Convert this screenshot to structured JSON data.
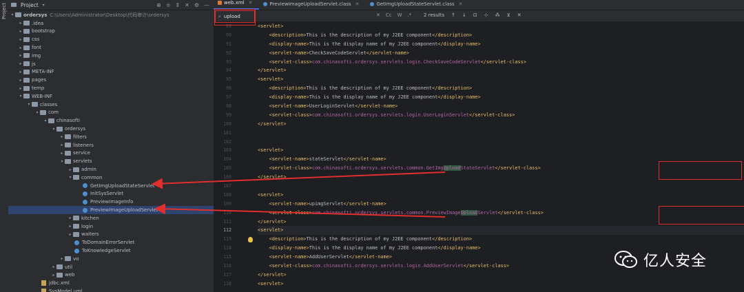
{
  "project_panel": {
    "title": "Project",
    "vertical_tab": "Project",
    "root_name": "ordersys",
    "root_path": "C:\\Users\\Administrator\\Desktop\\代码审计\\ordersys",
    "tree": [
      {
        "label": "ordersys",
        "depth": 0,
        "kind": "folder",
        "expanded": true
      },
      {
        "label": ".idea",
        "depth": 1,
        "kind": "folder",
        "expanded": false
      },
      {
        "label": "bootstrap",
        "depth": 1,
        "kind": "folder",
        "expanded": false
      },
      {
        "label": "css",
        "depth": 1,
        "kind": "folder",
        "expanded": false
      },
      {
        "label": "font",
        "depth": 1,
        "kind": "folder",
        "expanded": false
      },
      {
        "label": "img",
        "depth": 1,
        "kind": "folder",
        "expanded": false
      },
      {
        "label": "js",
        "depth": 1,
        "kind": "folder",
        "expanded": false
      },
      {
        "label": "META-INF",
        "depth": 1,
        "kind": "folder",
        "expanded": false
      },
      {
        "label": "pages",
        "depth": 1,
        "kind": "folder",
        "expanded": false
      },
      {
        "label": "temp",
        "depth": 1,
        "kind": "folder",
        "expanded": false
      },
      {
        "label": "WEB-INF",
        "depth": 1,
        "kind": "folder",
        "expanded": true
      },
      {
        "label": "classes",
        "depth": 2,
        "kind": "folder",
        "expanded": true
      },
      {
        "label": "com",
        "depth": 3,
        "kind": "folder",
        "expanded": true
      },
      {
        "label": "chinasofti",
        "depth": 4,
        "kind": "folder",
        "expanded": true
      },
      {
        "label": "ordersys",
        "depth": 5,
        "kind": "folder",
        "expanded": true
      },
      {
        "label": "filters",
        "depth": 6,
        "kind": "folder",
        "expanded": false
      },
      {
        "label": "listeners",
        "depth": 6,
        "kind": "folder",
        "expanded": false
      },
      {
        "label": "service",
        "depth": 6,
        "kind": "folder",
        "expanded": false
      },
      {
        "label": "servlets",
        "depth": 6,
        "kind": "folder",
        "expanded": true
      },
      {
        "label": "admin",
        "depth": 7,
        "kind": "folder",
        "expanded": false
      },
      {
        "label": "common",
        "depth": 7,
        "kind": "folder",
        "expanded": true
      },
      {
        "label": "GetImgUploadStateServlet",
        "depth": 8,
        "kind": "class"
      },
      {
        "label": "InitSysServlet",
        "depth": 8,
        "kind": "class"
      },
      {
        "label": "PreviewImageInfo",
        "depth": 8,
        "kind": "class"
      },
      {
        "label": "PreviewImageUploadServlet",
        "depth": 8,
        "kind": "class",
        "selected": true
      },
      {
        "label": "kitchen",
        "depth": 7,
        "kind": "folder",
        "expanded": false
      },
      {
        "label": "login",
        "depth": 7,
        "kind": "folder",
        "expanded": false
      },
      {
        "label": "waiters",
        "depth": 7,
        "kind": "folder",
        "expanded": false
      },
      {
        "label": "ToDomainErrorServlet",
        "depth": 7,
        "kind": "class"
      },
      {
        "label": "ToKnowledgeServlet",
        "depth": 7,
        "kind": "class"
      },
      {
        "label": "vo",
        "depth": 6,
        "kind": "folder",
        "expanded": false
      },
      {
        "label": "util",
        "depth": 5,
        "kind": "folder",
        "expanded": false
      },
      {
        "label": "web",
        "depth": 5,
        "kind": "folder",
        "expanded": false
      },
      {
        "label": "jdbc.xml",
        "depth": 3,
        "kind": "file"
      },
      {
        "label": "SysModel.uml",
        "depth": 3,
        "kind": "file"
      }
    ]
  },
  "tabs": [
    {
      "label": "web.xml",
      "type": "xml",
      "active": true
    },
    {
      "label": "PreviewImageUploadServlet.class",
      "type": "class",
      "active": false
    },
    {
      "label": "GetImgUploadStateServlet.class",
      "type": "class",
      "active": false
    }
  ],
  "find": {
    "query": "upload",
    "match_case": "Cc",
    "words": "W",
    "regex": ".*",
    "results": "2 results"
  },
  "code": {
    "current_line": 112,
    "lines": [
      {
        "n": 89,
        "text": "<servlet>"
      },
      {
        "n": 90,
        "text": "    <description>This is the description of my J2EE component</description>"
      },
      {
        "n": 91,
        "text": "    <display-name>This is the display name of my J2EE component</display-name>"
      },
      {
        "n": 92,
        "text": "    <servlet-name>CheckSaveCodeServlet</servlet-name>"
      },
      {
        "n": 93,
        "text": "    <servlet-class>com.chinasofti.ordersys.servlets.login.CheckSaveCodeServlet</servlet-class>"
      },
      {
        "n": 94,
        "text": "</servlet>"
      },
      {
        "n": 95,
        "text": "<servlet>"
      },
      {
        "n": 96,
        "text": "    <description>This is the description of my J2EE component</description>"
      },
      {
        "n": 97,
        "text": "    <display-name>This is the display name of my J2EE component</display-name>"
      },
      {
        "n": 98,
        "text": "    <servlet-name>UserLoginServlet</servlet-name>"
      },
      {
        "n": 99,
        "text": "    <servlet-class>com.chinasofti.ordersys.servlets.login.UserLoginServlet</servlet-class>"
      },
      {
        "n": 100,
        "text": "</servlet>"
      },
      {
        "n": 101,
        "text": ""
      },
      {
        "n": 102,
        "text": ""
      },
      {
        "n": 103,
        "text": "<servlet>"
      },
      {
        "n": 104,
        "text": "    <servlet-name>stateServlet</servlet-name>"
      },
      {
        "n": 105,
        "text": "    <servlet-class>com.chinasofti.ordersys.servlets.common.GetImgUploadStateServlet</servlet-class>"
      },
      {
        "n": 106,
        "text": "</servlet>"
      },
      {
        "n": 107,
        "text": ""
      },
      {
        "n": 108,
        "text": "<servlet>"
      },
      {
        "n": 109,
        "text": "    <servlet-name>upimgServlet</servlet-name>"
      },
      {
        "n": 110,
        "text": "    <servlet-class>com.chinasofti.ordersys.servlets.common.PreviewImageUploadServlet</servlet-class>"
      },
      {
        "n": 111,
        "text": "</servlet>"
      },
      {
        "n": 112,
        "text": "<servlet>"
      },
      {
        "n": 113,
        "text": "    <description>This is the description of my J2EE component</description>"
      },
      {
        "n": 114,
        "text": "    <display-name>This is the display name of my J2EE component</display-name>"
      },
      {
        "n": 115,
        "text": "    <servlet-name>AddUserServlet</servlet-name>"
      },
      {
        "n": 116,
        "text": "    <servlet-class>com.chinasofti.ordersys.servlets.login.AddUserServlet</servlet-class>"
      },
      {
        "n": 117,
        "text": "</servlet>"
      },
      {
        "n": 118,
        "text": "<servlet>"
      }
    ]
  },
  "watermark": {
    "text": "亿人安全"
  },
  "colors": {
    "tag": "#e8bf6a",
    "text": "#bcbec4",
    "class_path": "#b366a6",
    "annotation": "#e0302e",
    "selection": "#2e436e"
  }
}
